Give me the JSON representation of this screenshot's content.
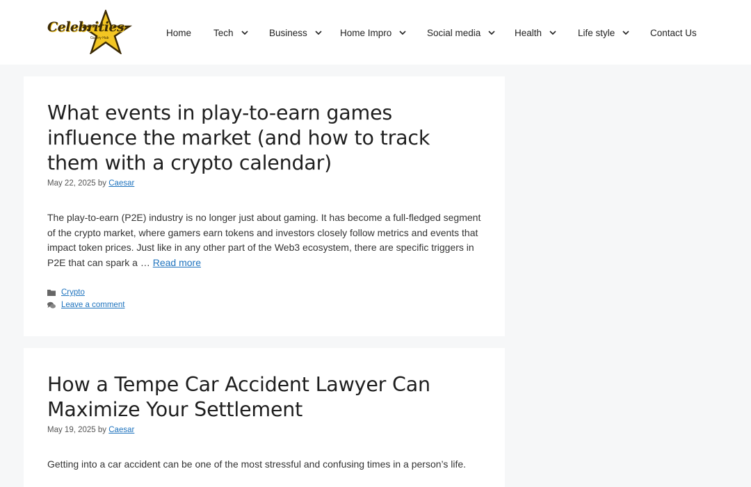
{
  "site": {
    "logo_text": "Celebrities",
    "logo_subtext": "Gallery Hub",
    "accent_color": "#f3c623",
    "link_color": "#1e73be"
  },
  "nav": {
    "items": [
      {
        "label": "Home",
        "has_dropdown": false
      },
      {
        "label": "Tech",
        "has_dropdown": true
      },
      {
        "label": "Business",
        "has_dropdown": true
      },
      {
        "label": "Home Impro",
        "has_dropdown": true
      },
      {
        "label": "Social media",
        "has_dropdown": true
      },
      {
        "label": "Health",
        "has_dropdown": true
      },
      {
        "label": "Life style",
        "has_dropdown": true
      },
      {
        "label": "Contact Us",
        "has_dropdown": false
      }
    ]
  },
  "posts": [
    {
      "title": "What events in play-to-earn games influence the market (and how to track them with a crypto calendar)",
      "date": "May 22, 2025",
      "by": "by",
      "author": "Caesar",
      "excerpt": "The play-to-earn (P2E) industry is no longer just about gaming. It has become a full-fledged segment of the crypto market, where gamers earn tokens and investors closely follow metrics and events that impact token prices. Just like in any other part of the Web3 ecosystem, there are specific triggers in P2E that can spark a …",
      "read_more": "Read more",
      "category": "Crypto",
      "comment_link": "Leave a comment"
    },
    {
      "title": "How a Tempe Car Accident Lawyer Can Maximize Your Settlement",
      "date": "May 19, 2025",
      "by": "by",
      "author": "Caesar",
      "excerpt": "Getting into a car accident can be one of the most stressful and confusing times in a person’s life."
    }
  ]
}
